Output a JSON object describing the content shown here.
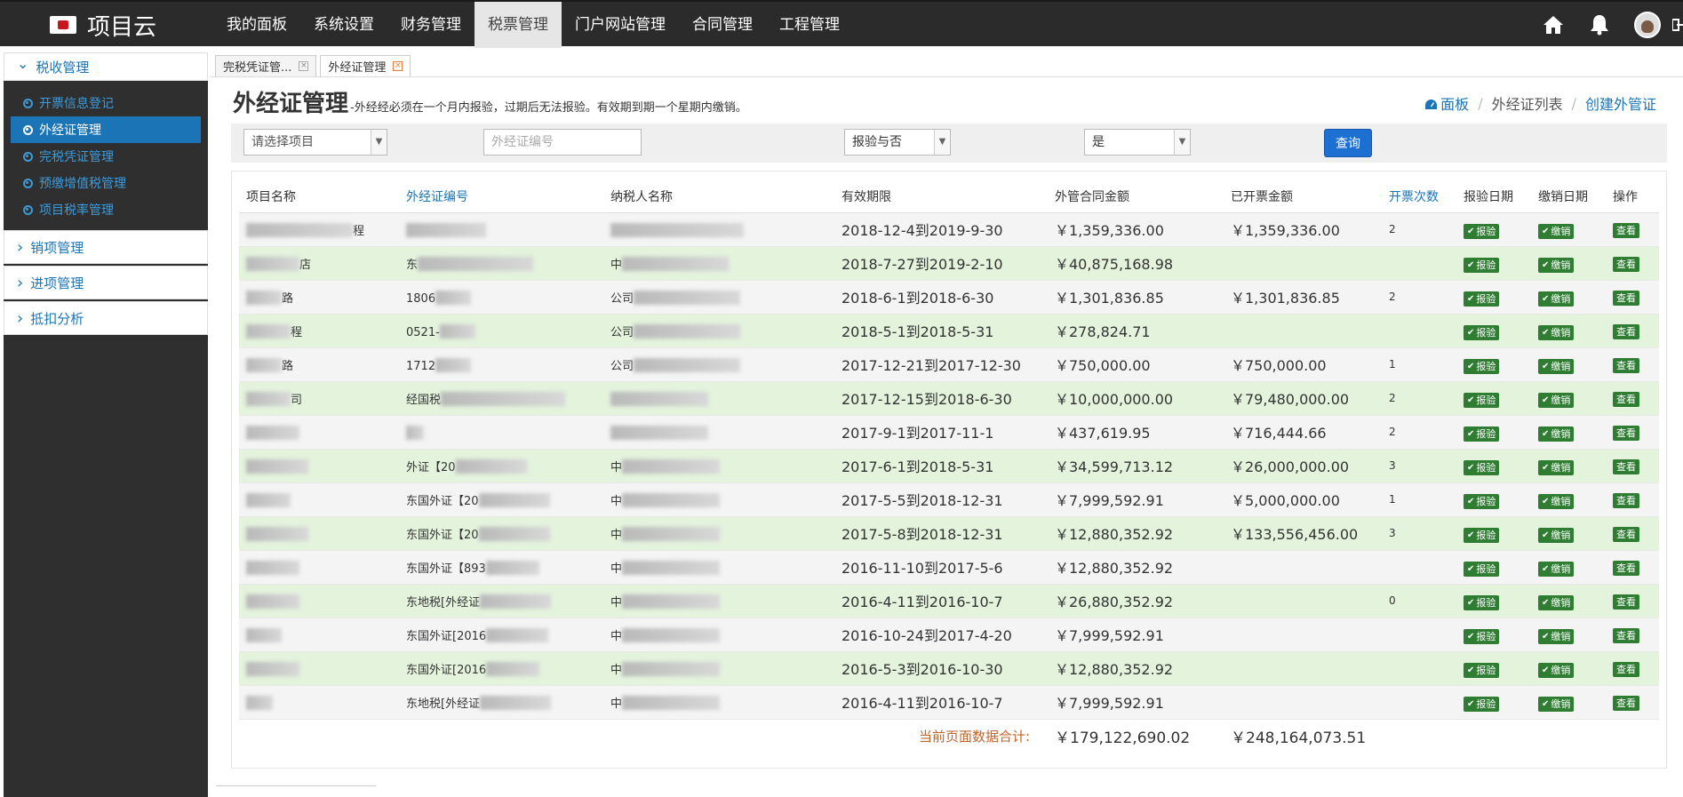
{
  "app": {
    "title": "项目云"
  },
  "menu": [
    {
      "label": "我的面板"
    },
    {
      "label": "系统设置"
    },
    {
      "label": "财务管理"
    },
    {
      "label": "税票管理",
      "active": true
    },
    {
      "label": "门户网站管理"
    },
    {
      "label": "合同管理"
    },
    {
      "label": "工程管理"
    }
  ],
  "nav_icons": [
    "home-icon",
    "bell-icon",
    "avatar"
  ],
  "sidebar": {
    "groups": [
      {
        "label": "税收管理",
        "expanded": true,
        "items": [
          {
            "label": "开票信息登记"
          },
          {
            "label": "外经证管理",
            "active": true
          },
          {
            "label": "完税凭证管理"
          },
          {
            "label": "预缴增值税管理"
          },
          {
            "label": "项目税率管理"
          }
        ]
      },
      {
        "label": "销项管理"
      },
      {
        "label": "进项管理"
      },
      {
        "label": "抵扣分析"
      }
    ]
  },
  "tabs": [
    {
      "label": "完税凭证管..."
    },
    {
      "label": "外经证管理",
      "active": true
    }
  ],
  "page": {
    "title": "外经证管理",
    "subtitle": "-外经经必须在一个月内报验，过期后无法报验。有效期到期一个星期内缴销。"
  },
  "breadcrumb": {
    "dashboard": "面板",
    "list": "外经证列表",
    "create": "创建外管证"
  },
  "filter": {
    "project_placeholder": "请选择项目",
    "cert_no_placeholder": "外经证编号",
    "inspected_value": "报验与否",
    "yes_value": "是",
    "query_label": "查询"
  },
  "table": {
    "headers": [
      "项目名称",
      "外经证编号",
      "纳税人名称",
      "有效期限",
      "外管合同金额",
      "已开票金额",
      "开票次数",
      "报验日期",
      "缴销日期",
      "操作"
    ],
    "link_headers": [
      1,
      6
    ],
    "rows": [
      {
        "name": "程",
        "cert": "",
        "taxpayer": "",
        "period": "2018-12-4到2019-9-30",
        "contract": "￥1,359,336.00",
        "invoiced": "￥1,359,336.00",
        "count": "2"
      },
      {
        "name": "店",
        "cert": "东",
        "taxpayer": "中",
        "period": "2018-7-27到2019-2-10",
        "contract": "￥40,875,168.98",
        "invoiced": "",
        "count": ""
      },
      {
        "name": "路",
        "cert": "1806",
        "taxpayer": "公司",
        "period": "2018-6-1到2018-6-30",
        "contract": "￥1,301,836.85",
        "invoiced": "￥1,301,836.85",
        "count": "2"
      },
      {
        "name": "程",
        "cert": "0521-",
        "taxpayer": "公司",
        "period": "2018-5-1到2018-5-31",
        "contract": "￥278,824.71",
        "invoiced": "",
        "count": ""
      },
      {
        "name": "路",
        "cert": "1712",
        "taxpayer": "公司",
        "period": "2017-12-21到2017-12-30",
        "contract": "￥750,000.00",
        "invoiced": "￥750,000.00",
        "count": "1"
      },
      {
        "name": "司",
        "cert": "经国税",
        "taxpayer": "",
        "period": "2017-12-15到2018-6-30",
        "contract": "￥10,000,000.00",
        "invoiced": "￥79,480,000.00",
        "count": "2"
      },
      {
        "name": "",
        "cert": "",
        "taxpayer": "",
        "period": "2017-9-1到2017-11-1",
        "contract": "￥437,619.95",
        "invoiced": "￥716,444.66",
        "count": "2"
      },
      {
        "name": "",
        "cert": "外证【20",
        "taxpayer": "中",
        "period": "2017-6-1到2018-5-31",
        "contract": "￥34,599,713.12",
        "invoiced": "￥26,000,000.00",
        "count": "3"
      },
      {
        "name": "",
        "cert": "东国外证【20",
        "taxpayer": "中",
        "period": "2017-5-5到2018-12-31",
        "contract": "￥7,999,592.91",
        "invoiced": "￥5,000,000.00",
        "count": "1"
      },
      {
        "name": "",
        "cert": "东国外证【20",
        "taxpayer": "中",
        "period": "2017-5-8到2018-12-31",
        "contract": "￥12,880,352.92",
        "invoiced": "￥133,556,456.00",
        "count": "3"
      },
      {
        "name": "",
        "cert": "东国外证【893",
        "taxpayer": "中",
        "period": "2016-11-10到2017-5-6",
        "contract": "￥12,880,352.92",
        "invoiced": "",
        "count": ""
      },
      {
        "name": "",
        "cert": "东地税[外经证",
        "taxpayer": "中",
        "period": "2016-4-11到2016-10-7",
        "contract": "￥26,880,352.92",
        "invoiced": "",
        "count": "0"
      },
      {
        "name": "",
        "cert": "东国外证[2016",
        "taxpayer": "中",
        "period": "2016-10-24到2017-4-20",
        "contract": "￥7,999,592.91",
        "invoiced": "",
        "count": ""
      },
      {
        "name": "",
        "cert": "东国外证[2016",
        "taxpayer": "中",
        "period": "2016-5-3到2016-10-30",
        "contract": "￥12,880,352.92",
        "invoiced": "",
        "count": ""
      },
      {
        "name": "",
        "cert": "东地税[外经证",
        "taxpayer": "中",
        "period": "2016-4-11到2016-10-7",
        "contract": "￥7,999,592.91",
        "invoiced": "",
        "count": ""
      }
    ],
    "action_labels": {
      "inspect": "报验",
      "cancel": "缴销",
      "view": "查看"
    },
    "total_label": "当前页面数据合计:",
    "total_contract": "￥179,122,690.02",
    "total_invoiced": "￥248,164,073.51"
  },
  "colors": {
    "navbar": "#2b2b2b",
    "accent": "#1a74b5",
    "row_alt": "#e3f3dc",
    "action_green": "#2e7d32",
    "total_label": "#c0642b"
  }
}
